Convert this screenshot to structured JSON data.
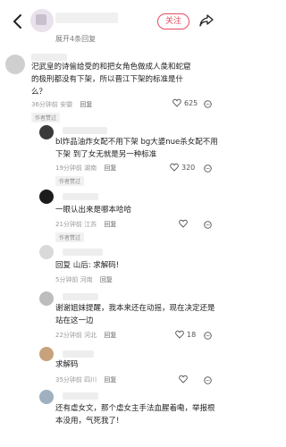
{
  "header": {
    "follow_label": "关注",
    "expand_label": "展开4条回复"
  },
  "comments": [
    {
      "text": "汜武皇的诗偷给受的和把女角色做成人彘和蛇窟的极刑都没有下架，所以晋江下架的标准是什么？",
      "meta": "36分钟前 安徽",
      "reply": "回复",
      "likes": "625",
      "badge": "作者赞过"
    },
    {
      "text": "bl炸品油炸女配不用下架 bg大婆nue杀女配不用下架 到了女无就是另一种标准",
      "meta": "19分钟前 湖南",
      "reply": "回复",
      "likes": "320",
      "badge": "作者赞过"
    },
    {
      "text": "一眼认出来是哪本哈哈",
      "meta": "21分钟前 江苏",
      "reply": "回复",
      "likes": "",
      "badge": "作者赞过"
    },
    {
      "text": "回复 山后: 求解码!",
      "meta": "5分钟前 河南",
      "reply": "回复",
      "likes": "",
      "badge": ""
    },
    {
      "text": "谢谢姐妹提醒，我本来还在动摇，现在决定还是站在这一边",
      "meta": "22分钟前 河北",
      "reply": "回复",
      "likes": "18",
      "badge": ""
    },
    {
      "text": "求解码",
      "meta": "35分钟前 四川",
      "reply": "回复",
      "likes": "",
      "badge": ""
    },
    {
      "text": "还有虐女文，那个虐女主手法血腥着嘞，举报根本没用，气死我了!",
      "meta": "",
      "reply": "",
      "likes": "",
      "badge": ""
    }
  ]
}
